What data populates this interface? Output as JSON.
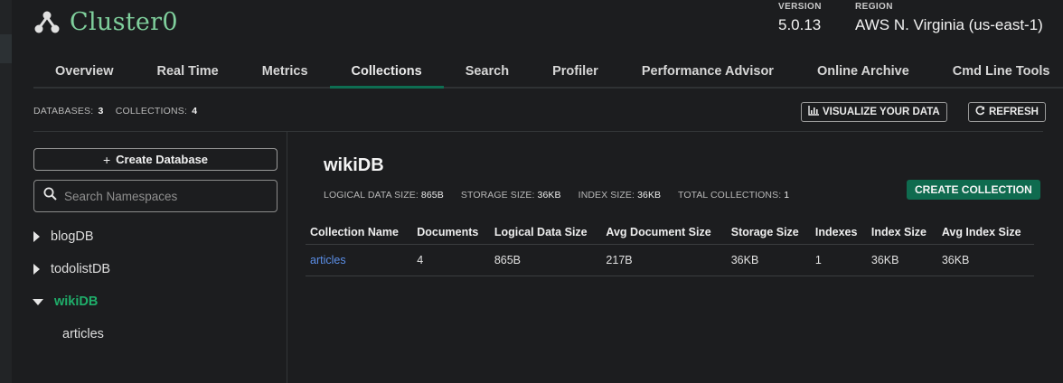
{
  "cluster": {
    "name": "Cluster0",
    "icon": "cluster-icon"
  },
  "meta": {
    "version_label": "VERSION",
    "version": "5.0.13",
    "region_label": "REGION",
    "region": "AWS N. Virginia (us-east-1)"
  },
  "tabs": [
    {
      "label": "Overview"
    },
    {
      "label": "Real Time"
    },
    {
      "label": "Metrics"
    },
    {
      "label": "Collections",
      "active": true
    },
    {
      "label": "Search"
    },
    {
      "label": "Profiler"
    },
    {
      "label": "Performance Advisor"
    },
    {
      "label": "Online Archive"
    },
    {
      "label": "Cmd Line Tools"
    }
  ],
  "stats": {
    "databases_label": "DATABASES:",
    "databases": "3",
    "collections_label": "COLLECTIONS:",
    "collections": "4"
  },
  "toolbar": {
    "visualize_label": "VISUALIZE YOUR DATA",
    "refresh_label": "REFRESH"
  },
  "sidebar": {
    "create_db_label": "Create Database",
    "search_placeholder": "Search Namespaces",
    "databases": [
      {
        "name": "blogDB",
        "expanded": false
      },
      {
        "name": "todolistDB",
        "expanded": false
      },
      {
        "name": "wikiDB",
        "expanded": true,
        "collections": [
          "articles"
        ]
      }
    ]
  },
  "main": {
    "db_title": "wikiDB",
    "logical_label": "LOGICAL DATA SIZE:",
    "logical": "865B",
    "storage_label": "STORAGE SIZE:",
    "storage": "36KB",
    "index_label": "INDEX SIZE:",
    "index": "36KB",
    "total_label": "TOTAL COLLECTIONS:",
    "total": "1",
    "create_collection_label": "CREATE COLLECTION",
    "table": {
      "headers": [
        "Collection Name",
        "Documents",
        "Logical Data Size",
        "Avg Document Size",
        "Storage Size",
        "Indexes",
        "Index Size",
        "Avg Index Size"
      ],
      "rows": [
        [
          "articles",
          "4",
          "865B",
          "217B",
          "36KB",
          "1",
          "36KB",
          "36KB"
        ]
      ]
    }
  },
  "colors": {
    "accent_green": "#0e6e52",
    "cluster_name": "#7fcf9c",
    "link_blue": "#5b8fe8",
    "active_db": "#1fae6a"
  }
}
